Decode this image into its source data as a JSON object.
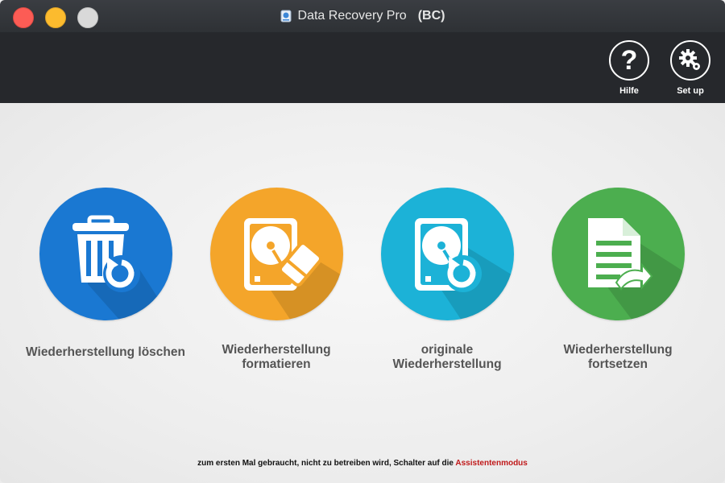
{
  "window": {
    "title": "Data Recovery Pro",
    "title_suffix": "(BC)"
  },
  "toolbar": {
    "help_label": "Hilfe",
    "setup_label": "Set up"
  },
  "options": [
    {
      "label": "Wiederherstellung löschen",
      "color": "#1a78d2",
      "icon": "trash-restore-icon"
    },
    {
      "label_line1": "Wiederherstellung",
      "label_line2": "formatieren",
      "color": "#f4a52a",
      "icon": "hdd-eraser-icon"
    },
    {
      "label_line1": "originale",
      "label_line2": "Wiederherstellung",
      "color": "#1cb2d7",
      "icon": "hdd-restore-icon"
    },
    {
      "label_line1": "Wiederherstellung",
      "label_line2": "fortsetzen",
      "color": "#4cae4f",
      "icon": "document-resume-icon"
    }
  ],
  "footer": {
    "text": "zum ersten Mal gebraucht, nicht zu betreiben wird, Schalter auf die ",
    "link": "Assistentenmodus"
  }
}
